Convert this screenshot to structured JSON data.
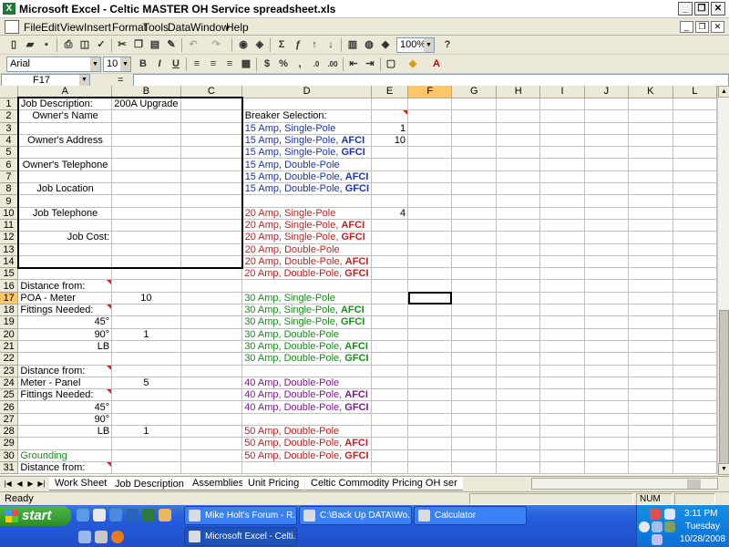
{
  "window": {
    "title": "Microsoft Excel - Celtic MASTER OH Service spreadsheet.xls"
  },
  "menu": [
    "File",
    "Edit",
    "View",
    "Insert",
    "Format",
    "Tools",
    "Data",
    "Window",
    "Help"
  ],
  "toolbar": {
    "zoom": "100%",
    "font": "Arial",
    "size": "10"
  },
  "formula_bar": {
    "cell": "F17",
    "fx": "=",
    "value": ""
  },
  "columns": [
    "A",
    "B",
    "C",
    "D",
    "E",
    "F",
    "G",
    "H",
    "I",
    "J",
    "K",
    "L"
  ],
  "cells": {
    "r1": {
      "a": "Job Description:",
      "b": "200A Upgrade"
    },
    "r2": {
      "a": "Owner's Name",
      "d": "Breaker Selection:"
    },
    "r3": {
      "d": "15 Amp, Single-Pole",
      "e": "1"
    },
    "r4": {
      "a": "Owner's Address",
      "d1": "15 Amp, Single-Pole, ",
      "d2": "AFCI",
      "e": "10"
    },
    "r5": {
      "d1": "15 Amp, Single-Pole, ",
      "d2": "GFCI"
    },
    "r6": {
      "a": "Owner's Telephone",
      "d": "15 Amp, Double-Pole"
    },
    "r7": {
      "d1": "15 Amp, Double-Pole, ",
      "d2": "AFCI"
    },
    "r8": {
      "a": "Job Location",
      "d1": "15 Amp, Double-Pole, ",
      "d2": "GFCI"
    },
    "r10": {
      "a": "Job Telephone",
      "d": "20 Amp, Single-Pole",
      "e": "4"
    },
    "r11": {
      "d1": "20 Amp, Single-Pole, ",
      "d2": "AFCI"
    },
    "r12": {
      "a": "Job Cost:",
      "d1": "20 Amp, Single-Pole, ",
      "d2": "GFCI"
    },
    "r13": {
      "d": "20 Amp, Double-Pole"
    },
    "r14": {
      "d1": "20 Amp, Double-Pole, ",
      "d2": "AFCI"
    },
    "r15": {
      "d1": "20 Amp, Double-Pole, ",
      "d2": "GFCI"
    },
    "r16": {
      "a": "Distance from:"
    },
    "r17": {
      "a": "POA - Meter",
      "b": "10",
      "d": "30 Amp, Single-Pole"
    },
    "r18": {
      "a": "Fittings Needed:",
      "d1": "30 Amp, Single-Pole, ",
      "d2": "AFCI"
    },
    "r19": {
      "a": "45°",
      "d1": "30 Amp, Single-Pole, ",
      "d2": "GFCI"
    },
    "r20": {
      "a": "90°",
      "b": "1",
      "d": "30 Amp, Double-Pole"
    },
    "r21": {
      "a": "LB",
      "d1": "30 Amp, Double-Pole, ",
      "d2": "AFCI"
    },
    "r22": {
      "d1": "30 Amp, Double-Pole, ",
      "d2": "GFCI"
    },
    "r23": {
      "a": "Distance from:"
    },
    "r24": {
      "a": "Meter - Panel",
      "b": "5",
      "d": "40 Amp, Double-Pole"
    },
    "r25": {
      "a": "Fittings Needed:",
      "d1": "40 Amp, Double-Pole, ",
      "d2": "AFCI"
    },
    "r26": {
      "a": "45°",
      "d1": "40 Amp, Double-Pole, ",
      "d2": "GFCI"
    },
    "r27": {
      "a": "90°"
    },
    "r28": {
      "a": "LB",
      "b": "1",
      "d": "50 Amp, Double-Pole"
    },
    "r29": {
      "d1": "50 Amp, Double-Pole, ",
      "d2": "AFCI"
    },
    "r30": {
      "a": "Grounding",
      "d1": "50 Amp, Double-Pole, ",
      "d2": "GFCI"
    },
    "r31": {
      "a": "Distance from:"
    }
  },
  "sheet_tabs": [
    "Work Sheet",
    "Job Description",
    "Assemblies",
    "Unit Pricing",
    "Celtic Commodity Pricing OH ser"
  ],
  "status": {
    "left": "Ready",
    "num": "NUM"
  },
  "taskbar": {
    "start": "start",
    "tasks": [
      "Mike Holt's Forum - R...",
      "C:\\Back Up DATA\\Wo...",
      "Calculator",
      "Microsoft Excel - Celti..."
    ],
    "time": "3:11 PM",
    "day": "Tuesday",
    "date": "10/28/2008"
  }
}
